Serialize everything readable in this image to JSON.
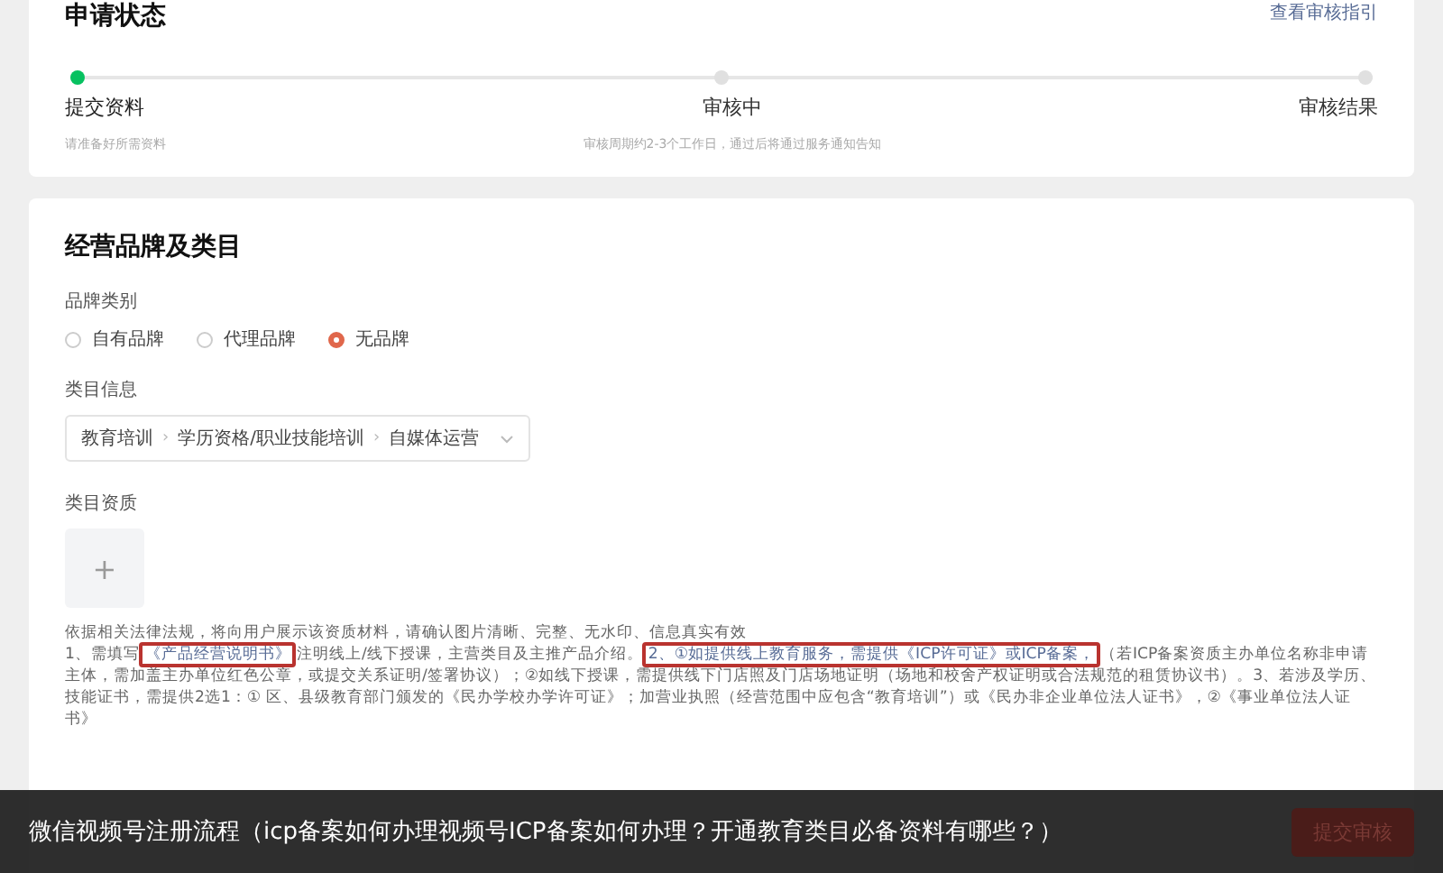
{
  "status_card": {
    "title": "申请状态",
    "guide_link": "查看审核指引",
    "steps": [
      {
        "label": "提交资料",
        "hint": "请准备好所需资料",
        "active": true
      },
      {
        "label": "审核中",
        "hint": "审核周期约2-3个工作日，通过后将通过服务通知告知",
        "active": false
      },
      {
        "label": "审核结果",
        "active": false
      }
    ]
  },
  "brand_card": {
    "title": "经营品牌及类目",
    "brand_label": "品牌类别",
    "brand_options": [
      {
        "label": "自有品牌",
        "selected": false
      },
      {
        "label": "代理品牌",
        "selected": false
      },
      {
        "label": "无品牌",
        "selected": true
      }
    ],
    "category_label": "类目信息",
    "category_separator": "›",
    "category_path": [
      "教育培训",
      "学历资格/职业技能培训",
      "自媒体运营"
    ],
    "qualification_label": "类目资质",
    "upload_symbol": "+",
    "notes": [
      {
        "text": "依据相关法律法规，将向用户展示该资质材料，请确认图片清晰、完整、无水印、信息真实有效",
        "boxed": false
      },
      {
        "text": "1、需填写",
        "boxed": false
      },
      {
        "text": "《产品经营说明书》",
        "boxed": true
      },
      {
        "text": "注明线上/线下授课，主营类目及主推产品介绍。",
        "boxed": false
      },
      {
        "text": "2、①如提供线上教育服务，需提供《ICP许可证》或ICP备案，",
        "boxed": true
      },
      {
        "text": "（若ICP备案资质主办单位名称非申请主体，需加盖主办单位红色公章，或提交关系证明/签署协议）；②如线下授课，需提供线下门店照及门店场地证明（场地和校舍产权证明或合法规范的租赁协议书）。3、若涉及学历、技能证书，需提供2选1：① 区、县级教育部门颁发的《民办学校办学许可证》；加营业执照（经营范围中应包含“教育培训”）或《民办非企业单位法人证书》，②《事业单位法人证书》",
        "boxed": false
      }
    ]
  },
  "caption": {
    "text": "微信视频号注册流程（icp备案如何办理视频号ICP备案如何办理？开通教育类目必备资料有哪些？）",
    "button": "提交审核"
  }
}
